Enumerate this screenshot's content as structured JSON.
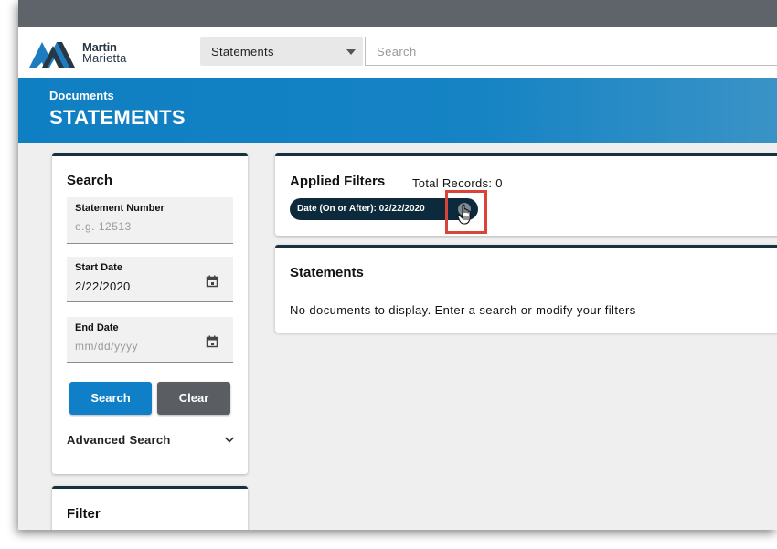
{
  "brand": {
    "line1": "Martin",
    "line2": "Marietta",
    "color": "#1d7bbf"
  },
  "header": {
    "doc_type_selected": "Statements",
    "search_placeholder": "Search"
  },
  "banner": {
    "breadcrumb": "Documents",
    "title": "STATEMENTS"
  },
  "search_panel": {
    "title": "Search",
    "statement_number": {
      "label": "Statement Number",
      "placeholder": "e.g. 12513"
    },
    "start_date": {
      "label": "Start Date",
      "value": "2/22/2020"
    },
    "end_date": {
      "label": "End Date",
      "placeholder": "mm/dd/yyyy"
    },
    "search_button": "Search",
    "clear_button": "Clear",
    "advanced_search": "Advanced Search"
  },
  "filter_panel": {
    "title": "Filter"
  },
  "applied_filters": {
    "title": "Applied Filters",
    "total_records": "Total Records: 0",
    "chips": [
      {
        "label": "Date (On or After): 02/22/2020"
      }
    ]
  },
  "statements": {
    "title": "Statements",
    "empty_message": "No documents to display. Enter a search or modify your filters"
  },
  "colors": {
    "topbar": "#5f646b",
    "banner": "#0f7fc3",
    "primary_button": "#0f80c7",
    "secondary_button": "#5a5e62",
    "chip": "#0d2a3c",
    "highlight": "#d9443a"
  }
}
